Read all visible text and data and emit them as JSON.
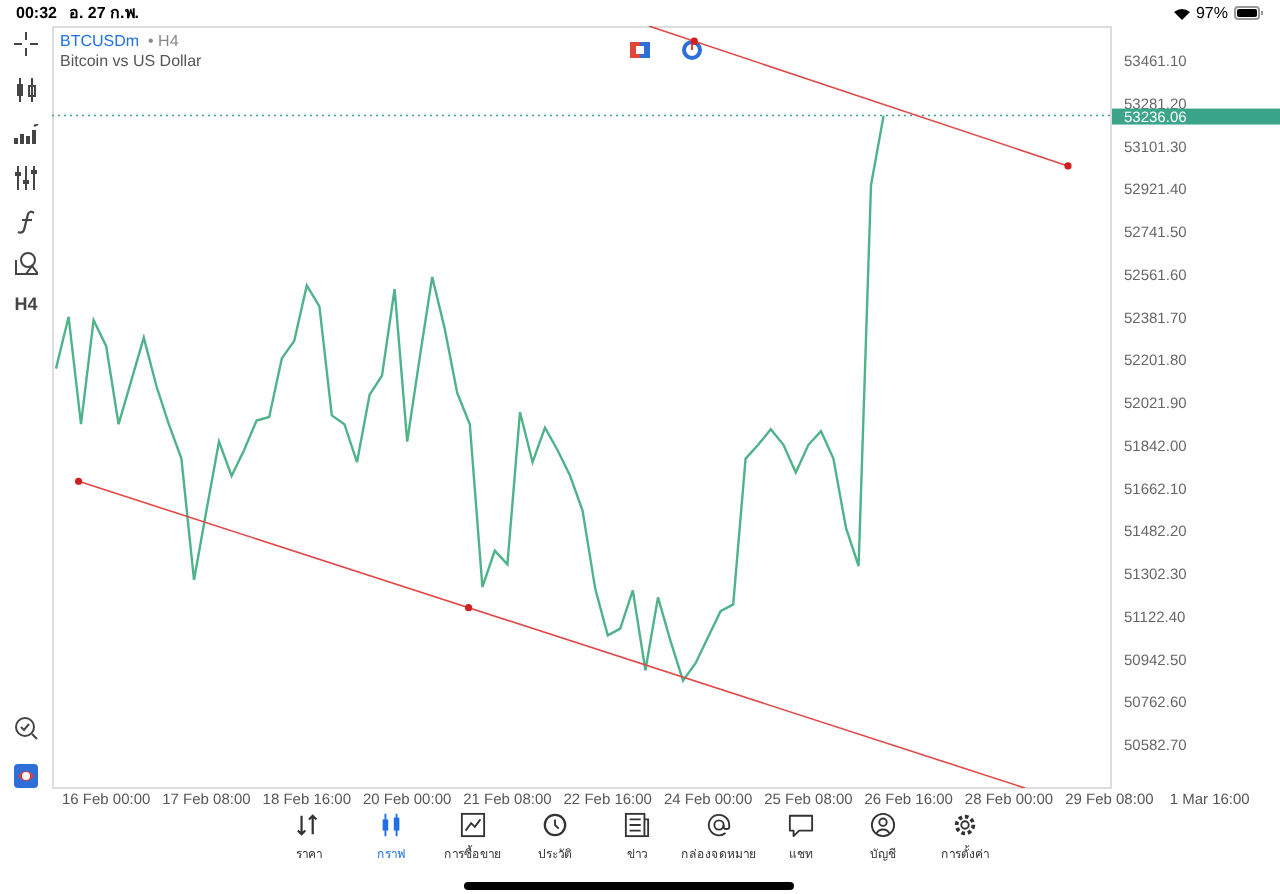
{
  "status_bar": {
    "time": "00:32",
    "date": "อ. 27 ก.พ.",
    "battery": "97%"
  },
  "symbol": {
    "timeframe": "• H4",
    "description": "Bitcoin vs US Dollar"
  },
  "left_toolbar": {
    "timeframe_button": "H4"
  },
  "drawings": [
    {
      "kind": "trendline"
    },
    {
      "kind": "trendline"
    }
  ],
  "chart_data": {
    "type": "line",
    "ylim": [
      50406,
      53613
    ],
    "ref_lines": [
      {
        "axis": "y",
        "value": 53236.06,
        "label": "53236.06"
      }
    ],
    "categories": [
      null,
      null,
      null,
      null,
      "16 Feb 00:00",
      null,
      null,
      null,
      null,
      null,
      null,
      null,
      "17 Feb 08:00",
      null,
      null,
      null,
      null,
      null,
      null,
      null,
      "18 Feb 16:00",
      null,
      null,
      null,
      null,
      null,
      null,
      null,
      "20 Feb 00:00",
      null,
      null,
      null,
      null,
      null,
      null,
      null,
      "21 Feb 08:00",
      null,
      null,
      null,
      null,
      null,
      null,
      null,
      "22 Feb 16:00",
      null,
      null,
      null,
      null,
      null,
      null,
      null,
      "24 Feb 00:00",
      null,
      null,
      null,
      null,
      null,
      null,
      null,
      "25 Feb 08:00",
      null,
      null,
      null,
      null,
      null,
      null,
      null,
      "26 Feb 16:00",
      null,
      null,
      null,
      null,
      null,
      null,
      null,
      "28 Feb 00:00",
      null,
      null,
      null,
      null,
      null,
      null,
      null,
      "29 Feb 08:00",
      null,
      null,
      null,
      null,
      null,
      null,
      null,
      "1 Mar 16:00"
    ],
    "series": [
      {
        "name": "BTCUSDm",
        "color": "#4fb38a",
        "values": [
          52171,
          52389,
          51937,
          52375,
          52265,
          51937,
          52120,
          52302,
          52098,
          51937,
          51792,
          51281,
          51573,
          51864,
          51719,
          51828,
          51952,
          51967,
          52214,
          52287,
          52521,
          52433,
          51974,
          51937,
          51777,
          52061,
          52142,
          52506,
          51864,
          52214,
          52557,
          52338,
          52069,
          51937,
          51252,
          51405,
          51347,
          51988,
          51777,
          51923,
          51828,
          51719,
          51573,
          51245,
          51048,
          51077,
          51238,
          50902,
          51208,
          51026,
          50858,
          50931,
          51041,
          51150,
          51179,
          51792,
          51850,
          51916,
          51850,
          51733,
          51850,
          51908,
          51792,
          51500,
          51340,
          52943,
          53236,
          null,
          null,
          null,
          null,
          null,
          null,
          null,
          null,
          null,
          null,
          null,
          null,
          null,
          null,
          null,
          null,
          null,
          null,
          null,
          null,
          null,
          null,
          null,
          null,
          null,
          null
        ]
      }
    ],
    "yticks": [
      {
        "value": 53461.1,
        "label": "53461.10"
      },
      {
        "value": 53281.2,
        "label": "53281.20"
      },
      {
        "value": 53101.3,
        "label": "53101.30"
      },
      {
        "value": 52921.4,
        "label": "52921.40"
      },
      {
        "value": 52741.5,
        "label": "52741.50"
      },
      {
        "value": 52561.6,
        "label": "52561.60"
      },
      {
        "value": 52381.7,
        "label": "52381.70"
      },
      {
        "value": 52201.8,
        "label": "52201.80"
      },
      {
        "value": 52021.9,
        "label": "52021.90"
      },
      {
        "value": 51842,
        "label": "51842.00"
      },
      {
        "value": 51662.1,
        "label": "51662.10"
      },
      {
        "value": 51482.2,
        "label": "51482.20"
      },
      {
        "value": 51302.3,
        "label": "51302.30"
      },
      {
        "value": 51122.4,
        "label": "51122.40"
      },
      {
        "value": 50942.5,
        "label": "50942.50"
      },
      {
        "value": 50762.6,
        "label": "50762.60"
      },
      {
        "value": 50582.7,
        "label": "50582.70"
      }
    ]
  },
  "tabs": [
    {
      "label": "ราคา",
      "selected": false
    },
    {
      "label": "กราฟ",
      "selected": true
    },
    {
      "label": "การซื้อขาย",
      "selected": false
    },
    {
      "label": "ประวัติ",
      "selected": false
    },
    {
      "label": "ข่าว",
      "selected": false
    },
    {
      "label": "กล่องจดหมาย",
      "selected": false
    },
    {
      "label": "แชท",
      "selected": false
    },
    {
      "label": "บัญชี",
      "selected": false
    },
    {
      "label": "การตั้งค่า",
      "selected": false
    }
  ]
}
